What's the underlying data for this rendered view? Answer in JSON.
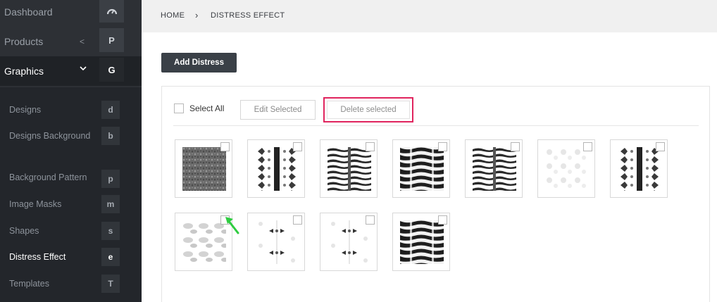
{
  "sidebar": {
    "top_items": [
      {
        "label": "Dashboard",
        "badge_icon": "dashboard-gauge-icon",
        "chevron": ""
      },
      {
        "label": "Products",
        "badge": "P",
        "chevron": "<"
      },
      {
        "label": "Graphics",
        "badge": "G",
        "chevron": "⌄"
      }
    ],
    "sub_items": [
      {
        "label": "Designs",
        "badge": "d"
      },
      {
        "label": "Designs Background",
        "badge": "b"
      },
      {
        "label": "Background Pattern",
        "badge": "p"
      },
      {
        "label": "Image Masks",
        "badge": "m"
      },
      {
        "label": "Shapes",
        "badge": "s"
      },
      {
        "label": "Distress Effect",
        "badge": "e"
      },
      {
        "label": "Templates",
        "badge": "T"
      }
    ]
  },
  "breadcrumb": {
    "home": "HOME",
    "separator": "›",
    "current": "DISTRESS EFFECT"
  },
  "actions": {
    "add_label": "Add Distress",
    "select_all_label": "Select All",
    "edit_label": "Edit Selected",
    "delete_label": "Delete selected"
  },
  "colors": {
    "highlight": "#e0245e",
    "arrow": "#2ecc40"
  },
  "thumbnails": [
    {
      "name": "distress-thumb-1",
      "style": "dark-mosaic"
    },
    {
      "name": "distress-thumb-2",
      "style": "mirrored-stripes"
    },
    {
      "name": "distress-thumb-3",
      "style": "horizontal-bands"
    },
    {
      "name": "distress-thumb-4",
      "style": "dark-bands"
    },
    {
      "name": "distress-thumb-5",
      "style": "horizontal-bands"
    },
    {
      "name": "distress-thumb-6",
      "style": "faint"
    },
    {
      "name": "distress-thumb-7",
      "style": "mirrored-stripes"
    },
    {
      "name": "distress-thumb-8",
      "style": "soft-blobs"
    },
    {
      "name": "distress-thumb-9",
      "style": "light-symmetric"
    },
    {
      "name": "distress-thumb-10",
      "style": "light-symmetric"
    },
    {
      "name": "distress-thumb-11",
      "style": "dark-bands"
    }
  ]
}
